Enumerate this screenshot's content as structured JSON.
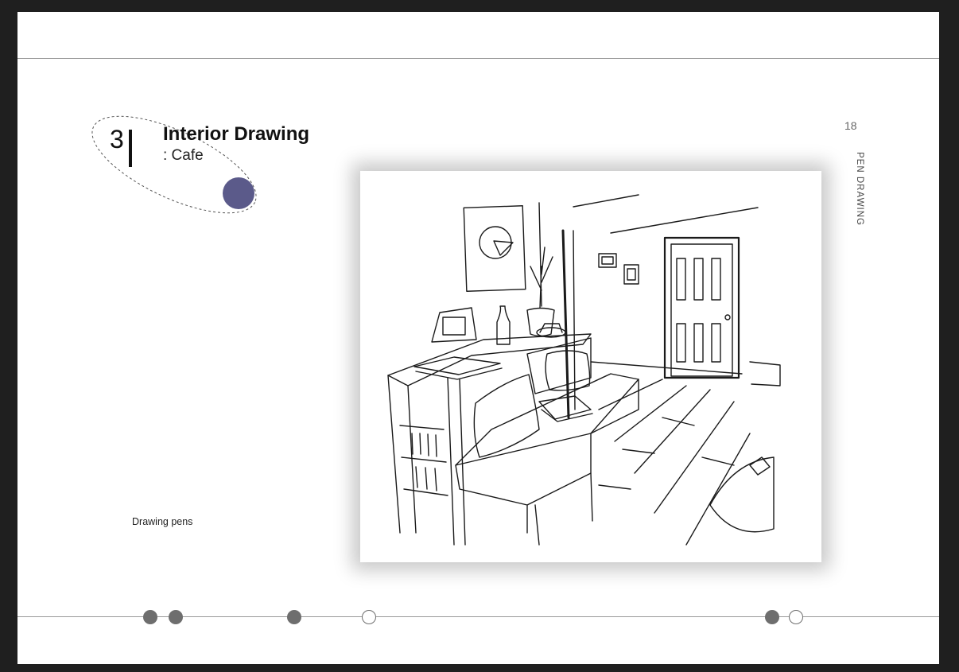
{
  "chapter": {
    "number": "3",
    "title": "Interior Drawing",
    "subtitle": ": Cafe"
  },
  "caption": "Drawing pens",
  "page_number": "18",
  "section_label": "PEN DRAWING",
  "colors": {
    "accent": "#5b5a8a",
    "dot": "#6e6e6e",
    "rule": "#9a9a9a",
    "background": "#1f1f1f"
  },
  "timeline": {
    "dots": [
      "filled",
      "filled",
      "filled",
      "hollow",
      "filled",
      "hollow"
    ]
  },
  "illustration": {
    "subject": "pen sketch of cafe interior"
  }
}
